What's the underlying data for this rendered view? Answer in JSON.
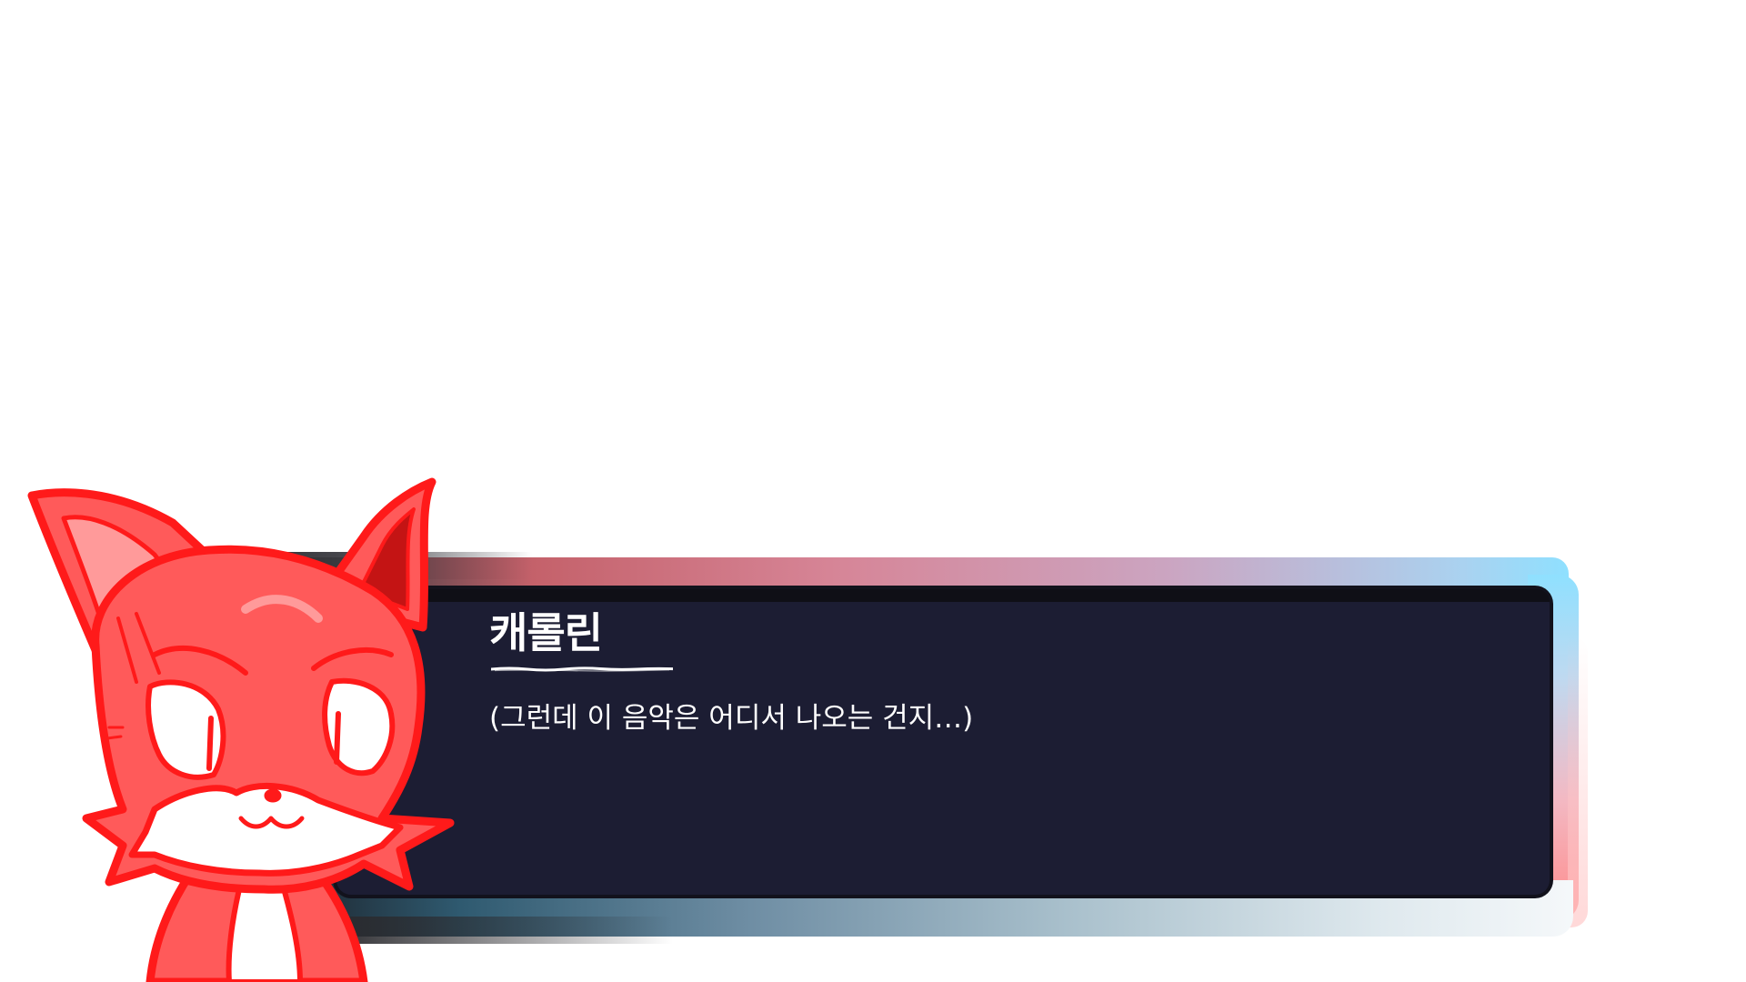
{
  "dialogue": {
    "speaker": "캐롤린",
    "text": "(그런데 이 음악은 어디서 나오는 건지…)"
  },
  "character": {
    "icon": "fox-character-portrait",
    "colors": {
      "outline": "#ff1a1a",
      "fur": "#ff5a5a",
      "fur_light": "#ff9a9a",
      "muzzle": "#ffffff"
    }
  },
  "theme": {
    "panel": "#1c1d33",
    "text": "#ffffff",
    "accent_cyan": "#8fe0ff",
    "accent_red": "#ff8a8a"
  }
}
